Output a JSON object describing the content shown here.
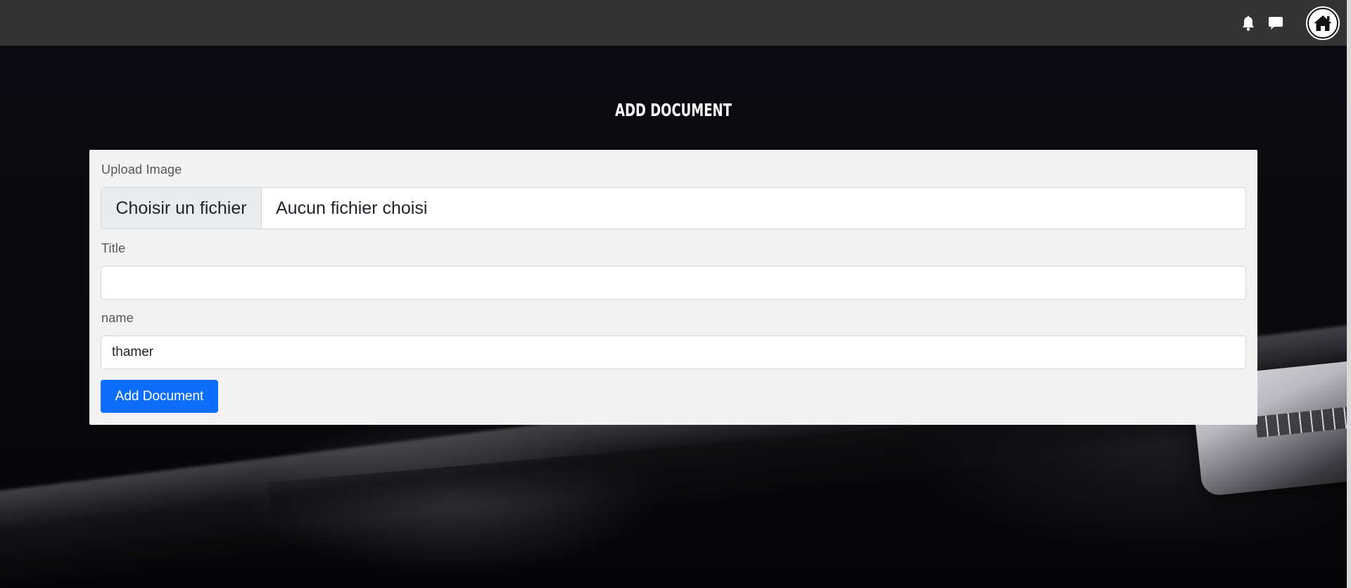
{
  "header": {
    "icons": [
      "bell-icon",
      "chat-icon",
      "home-icon"
    ],
    "colors": {
      "bar": "#343434",
      "icon": "#ffffff"
    }
  },
  "page": {
    "title": "ADD DOCUMENT"
  },
  "form": {
    "upload_label": "Upload Image",
    "file_button_label": "Choisir un fichier",
    "file_status": "Aucun fichier choisi",
    "title_label": "Title",
    "title_value": "",
    "name_label": "name",
    "name_value": "thamer",
    "submit_label": "Add Document",
    "colors": {
      "card": "#f2f2f2",
      "primary": "#0d6efd"
    }
  }
}
